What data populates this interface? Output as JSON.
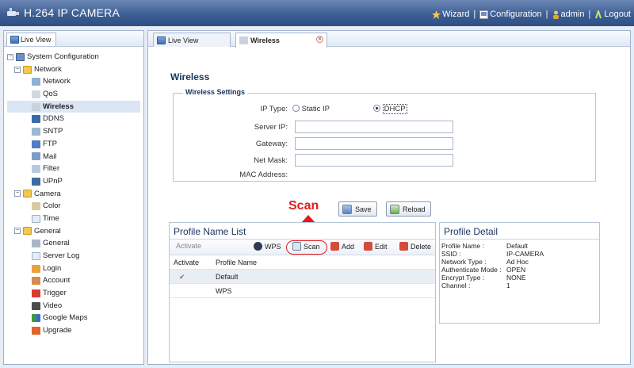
{
  "app": {
    "title": "H.264 IP CAMERA",
    "menu": {
      "wizard": "Wizard",
      "configuration": "Configuration",
      "user": "admin",
      "logout": "Logout",
      "separator": "|"
    }
  },
  "sidebar": {
    "tab_label": "Live View",
    "tree": {
      "root": "System Configuration",
      "network": {
        "label": "Network",
        "items": [
          "Network",
          "QoS",
          "Wireless",
          "DDNS",
          "SNTP",
          "FTP",
          "Mail",
          "Filter",
          "UPnP"
        ]
      },
      "camera": {
        "label": "Camera",
        "items": [
          "Color",
          "Time"
        ]
      },
      "general": {
        "label": "General",
        "items": [
          "General",
          "Server Log",
          "Login",
          "Account",
          "Trigger",
          "Video",
          "Google Maps",
          "Upgrade"
        ]
      },
      "expand_symbol": "−"
    }
  },
  "main": {
    "tabs": [
      "Live View",
      "Wireless"
    ],
    "close_symbol": "×",
    "page_title": "Wireless",
    "settings_legend": "Wireless Settings",
    "fields": {
      "ip_type_label": "IP Type:",
      "static_ip": "Static IP",
      "dhcp": "DHCP",
      "server_ip_label": "Server IP:",
      "gateway_label": "Gateway:",
      "net_mask_label": "Net Mask:",
      "mac_label": "MAC Address:",
      "server_ip_value": "",
      "gateway_value": "",
      "net_mask_value": "",
      "mac_value": ""
    },
    "ip_type_selected": "DHCP",
    "buttons": {
      "save": "Save",
      "reload": "Reload"
    },
    "annotation": {
      "scan_label": "Scan",
      "color": "#e21b1b"
    }
  },
  "profile_list": {
    "title": "Profile Name List",
    "toolbar": {
      "activate": "Activate",
      "wps": "WPS",
      "scan": "Scan",
      "add": "Add",
      "edit": "Edit",
      "delete": "Delete"
    },
    "columns": [
      "Activate",
      "Profile Name"
    ],
    "rows": [
      {
        "active_mark": "✔",
        "name": "Default"
      },
      {
        "active_mark": "",
        "name": "WPS"
      }
    ]
  },
  "profile_detail": {
    "title": "Profile Detail",
    "rows": [
      {
        "key": "Profile Name :",
        "value": "Default"
      },
      {
        "key": "SSID :",
        "value": "IP-CAMERA"
      },
      {
        "key": "Network Type :",
        "value": "Ad Hoc"
      },
      {
        "key": "Authenticate Mode :",
        "value": "OPEN"
      },
      {
        "key": "Encrypt Type :",
        "value": "NONE"
      },
      {
        "key": "Channel :",
        "value": "1"
      }
    ]
  },
  "colors": {
    "header": "#3e5f93",
    "accent": "#1b3660",
    "selection": "#dbe6f4"
  },
  "icons": [
    "camera-logo-icon",
    "wizard-icon",
    "config-icon",
    "user-icon",
    "logout-icon",
    "monitor-icon",
    "folder-icon",
    "save-icon",
    "reload-icon",
    "wps-icon",
    "scan-icon",
    "add-icon",
    "edit-icon",
    "delete-icon",
    "check-icon"
  ]
}
